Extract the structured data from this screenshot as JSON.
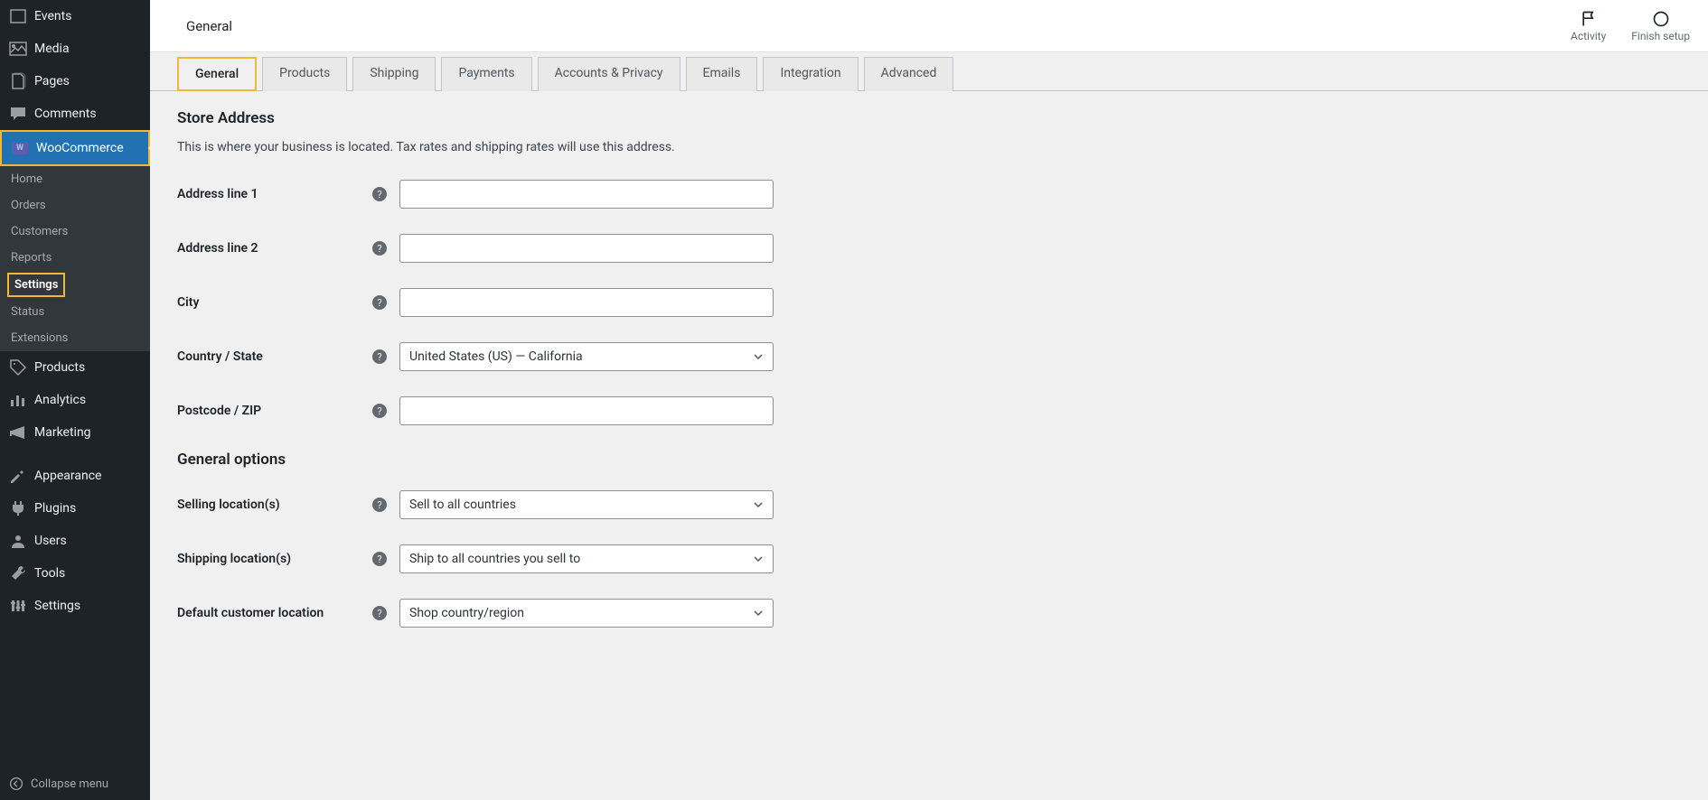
{
  "sidebar": {
    "items": [
      {
        "label": "Events",
        "icon": "calendar-icon"
      },
      {
        "label": "Media",
        "icon": "media-icon"
      },
      {
        "label": "Pages",
        "icon": "pages-icon"
      },
      {
        "label": "Comments",
        "icon": "comments-icon"
      },
      {
        "label": "WooCommerce",
        "icon": "woo-icon",
        "current": true
      },
      {
        "label": "Products",
        "icon": "products-icon"
      },
      {
        "label": "Analytics",
        "icon": "analytics-icon"
      },
      {
        "label": "Marketing",
        "icon": "marketing-icon"
      },
      {
        "label": "Appearance",
        "icon": "appearance-icon"
      },
      {
        "label": "Plugins",
        "icon": "plugins-icon"
      },
      {
        "label": "Users",
        "icon": "users-icon"
      },
      {
        "label": "Tools",
        "icon": "tools-icon"
      },
      {
        "label": "Settings",
        "icon": "settings-icon"
      }
    ],
    "submenu": [
      {
        "label": "Home"
      },
      {
        "label": "Orders"
      },
      {
        "label": "Customers"
      },
      {
        "label": "Reports"
      },
      {
        "label": "Settings",
        "current": true
      },
      {
        "label": "Status"
      },
      {
        "label": "Extensions"
      }
    ],
    "collapse_label": "Collapse menu"
  },
  "topbar": {
    "title": "General",
    "actions": {
      "activity": "Activity",
      "finish_setup": "Finish setup"
    }
  },
  "tabs": [
    {
      "label": "General",
      "active": true
    },
    {
      "label": "Products"
    },
    {
      "label": "Shipping"
    },
    {
      "label": "Payments"
    },
    {
      "label": "Accounts & Privacy"
    },
    {
      "label": "Emails"
    },
    {
      "label": "Integration"
    },
    {
      "label": "Advanced"
    }
  ],
  "sections": {
    "store_address": {
      "heading": "Store Address",
      "description": "This is where your business is located. Tax rates and shipping rates will use this address.",
      "fields": {
        "address1": {
          "label": "Address line 1",
          "value": ""
        },
        "address2": {
          "label": "Address line 2",
          "value": ""
        },
        "city": {
          "label": "City",
          "value": ""
        },
        "country_state": {
          "label": "Country / State",
          "value": "United States (US) — California"
        },
        "postcode": {
          "label": "Postcode / ZIP",
          "value": ""
        }
      }
    },
    "general_options": {
      "heading": "General options",
      "fields": {
        "selling_locations": {
          "label": "Selling location(s)",
          "value": "Sell to all countries"
        },
        "shipping_locations": {
          "label": "Shipping location(s)",
          "value": "Ship to all countries you sell to"
        },
        "default_customer_location": {
          "label": "Default customer location",
          "value": "Shop country/region"
        }
      }
    }
  }
}
